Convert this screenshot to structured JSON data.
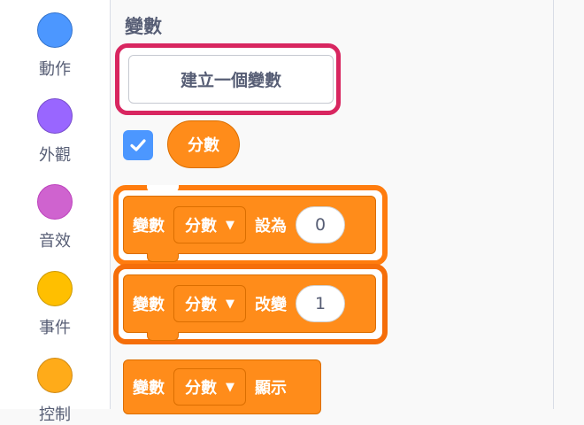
{
  "categories": [
    {
      "label": "動作",
      "color": "#4c97ff",
      "border": "#3373cc"
    },
    {
      "label": "外觀",
      "color": "#9966ff",
      "border": "#774dcb"
    },
    {
      "label": "音效",
      "color": "#cf63cf",
      "border": "#bd42bd"
    },
    {
      "label": "事件",
      "color": "#ffbf00",
      "border": "#cc9900"
    },
    {
      "label": "控制",
      "color": "#ffab19",
      "border": "#cf8b17"
    }
  ],
  "palette": {
    "title": "變數",
    "make_variable_label": "建立一個變數",
    "variable_reporter": "分數",
    "variable_checked": true
  },
  "blocks": [
    {
      "word": "變數",
      "dropdown": "分數",
      "action": "設為",
      "value": "0"
    },
    {
      "word": "變數",
      "dropdown": "分數",
      "action": "改變",
      "value": "1"
    },
    {
      "word": "變數",
      "dropdown": "分數",
      "action": "顯示"
    }
  ],
  "colors": {
    "highlight": "#d82660",
    "block_orange": "#ff8c1a",
    "highlight_orange": "#ff7c0e",
    "checkbox_blue": "#4c97ff"
  }
}
